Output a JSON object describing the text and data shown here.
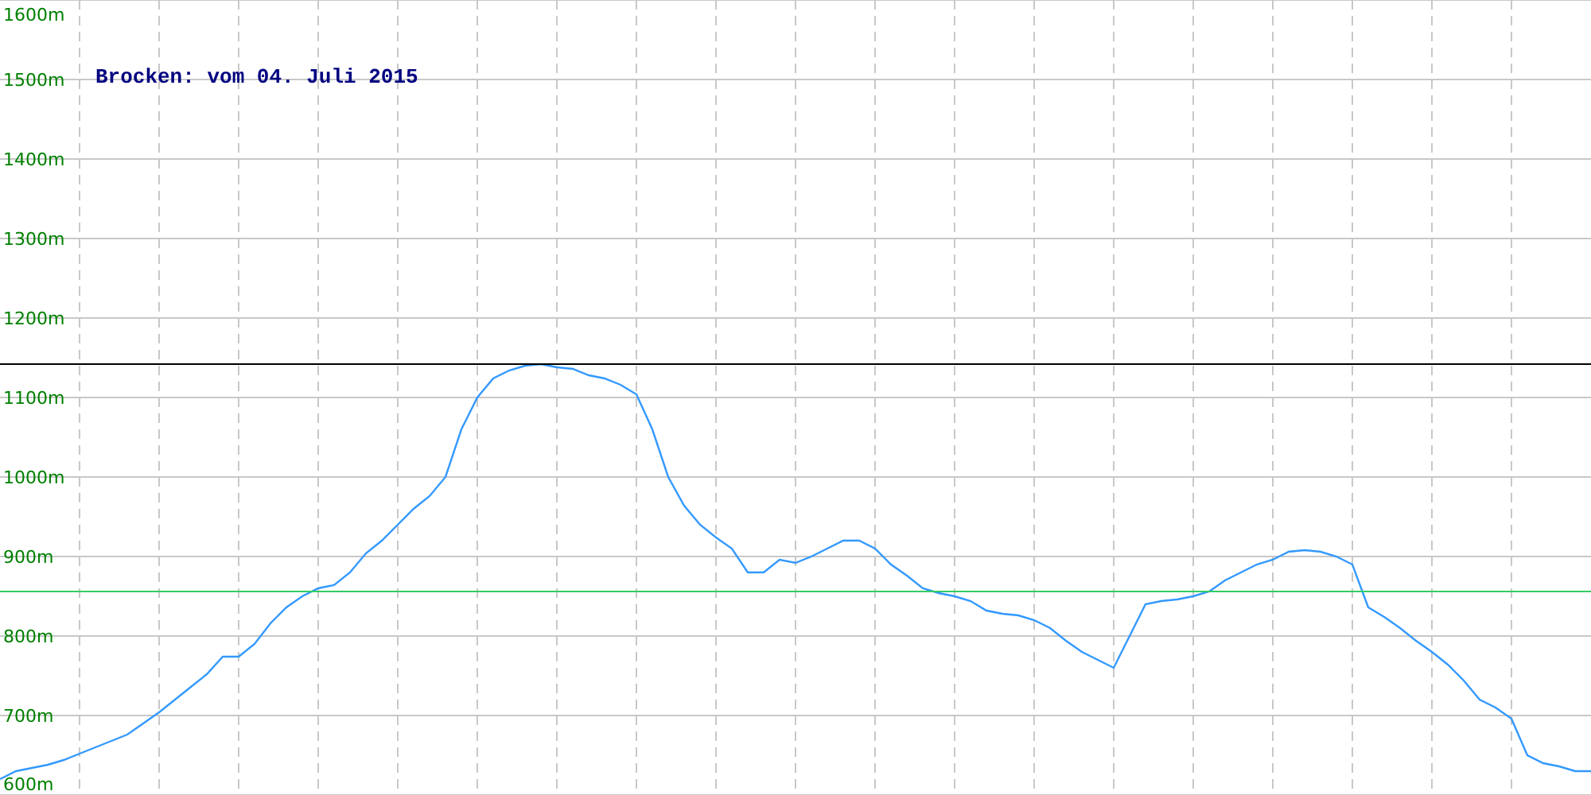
{
  "chart": {
    "chart_data": {
      "type": "line",
      "title": "Brocken: vom 04. Juli 2015",
      "categories": [
        null,
        null,
        null,
        null,
        null,
        null,
        null,
        null,
        null,
        null,
        null,
        null,
        null,
        null,
        null,
        null,
        null,
        null,
        null,
        null,
        null,
        null,
        null,
        null,
        null,
        null,
        null,
        null,
        null,
        null,
        null,
        null,
        null,
        null,
        null,
        null,
        null,
        null,
        null,
        null,
        null,
        null,
        null,
        null,
        null,
        null,
        null,
        null,
        null,
        null,
        null,
        null,
        null,
        null,
        null,
        null,
        null,
        null,
        null,
        null,
        null,
        null,
        null,
        null,
        null,
        null,
        null,
        null,
        null,
        null,
        null,
        null,
        null,
        null,
        null,
        null,
        null,
        null,
        null,
        null,
        null,
        null,
        null,
        null,
        null,
        null,
        null,
        null,
        null,
        null,
        null,
        null,
        null,
        null,
        null,
        null,
        null,
        null,
        null,
        null,
        null
      ],
      "series": [
        {
          "color": "#3399ff",
          "values": [
            620,
            630,
            634,
            638,
            644,
            652,
            660,
            668,
            676,
            690,
            704,
            720,
            736,
            752,
            774,
            774,
            790,
            816,
            836,
            850,
            860,
            864,
            880,
            904,
            920,
            940,
            960,
            976,
            1000,
            1060,
            1100,
            1124,
            1134,
            1140,
            1142,
            1138,
            1136,
            1128,
            1124,
            1116,
            1104,
            1060,
            1000,
            964,
            940,
            924,
            910,
            880,
            880,
            896,
            892,
            900,
            910,
            920,
            920,
            910,
            890,
            876,
            860,
            854,
            850,
            844,
            832,
            828,
            826,
            820,
            810,
            794,
            780,
            770,
            760,
            800,
            840,
            844,
            846,
            850,
            856,
            870,
            880,
            890,
            896,
            906,
            908,
            906,
            900,
            890,
            836,
            824,
            810,
            794,
            780,
            764,
            744,
            720,
            710,
            696,
            650,
            640,
            636,
            630,
            630
          ]
        },
        {
          "color": "#000000",
          "values": [
            1142,
            1142,
            1142,
            1142,
            1142,
            1142,
            1142,
            1142,
            1142,
            1142,
            1142,
            1142,
            1142,
            1142,
            1142,
            1142,
            1142,
            1142,
            1142,
            1142,
            1142,
            1142,
            1142,
            1142,
            1142,
            1142,
            1142,
            1142,
            1142,
            1142,
            1142,
            1142,
            1142,
            1142,
            1142,
            1142,
            1142,
            1142,
            1142,
            1142,
            1142,
            1142,
            1142,
            1142,
            1142,
            1142,
            1142,
            1142,
            1142,
            1142,
            1142,
            1142,
            1142,
            1142,
            1142,
            1142,
            1142,
            1142,
            1142,
            1142,
            1142,
            1142,
            1142,
            1142,
            1142,
            1142,
            1142,
            1142,
            1142,
            1142,
            1142,
            1142,
            1142,
            1142,
            1142,
            1142,
            1142,
            1142,
            1142,
            1142,
            1142,
            1142,
            1142,
            1142,
            1142,
            1142,
            1142,
            1142,
            1142,
            1142,
            1142,
            1142,
            1142,
            1142,
            1142,
            1142,
            1142,
            1142,
            1142,
            1142,
            1142
          ]
        },
        {
          "color": "#33cc66",
          "values": [
            856,
            856,
            856,
            856,
            856,
            856,
            856,
            856,
            856,
            856,
            856,
            856,
            856,
            856,
            856,
            856,
            856,
            856,
            856,
            856,
            856,
            856,
            856,
            856,
            856,
            856,
            856,
            856,
            856,
            856,
            856,
            856,
            856,
            856,
            856,
            856,
            856,
            856,
            856,
            856,
            856,
            856,
            856,
            856,
            856,
            856,
            856,
            856,
            856,
            856,
            856,
            856,
            856,
            856,
            856,
            856,
            856,
            856,
            856,
            856,
            856,
            856,
            856,
            856,
            856,
            856,
            856,
            856,
            856,
            856,
            856,
            856,
            856,
            856,
            856,
            856,
            856,
            856,
            856,
            856,
            856,
            856,
            856,
            856,
            856,
            856,
            856,
            856,
            856,
            856,
            856,
            856,
            856,
            856,
            856,
            856,
            856,
            856,
            856,
            856,
            856
          ]
        }
      ],
      "ylim": [
        600,
        1600
      ],
      "yticks": [
        {
          "value": 600,
          "label": "600m"
        },
        {
          "value": 700,
          "label": "700m"
        },
        {
          "value": 800,
          "label": "800m"
        },
        {
          "value": 900,
          "label": "900m"
        },
        {
          "value": 1000,
          "label": "1000m"
        },
        {
          "value": 1100,
          "label": "1100m"
        },
        {
          "value": 1200,
          "label": "1200m"
        },
        {
          "value": 1300,
          "label": "1300m"
        },
        {
          "value": 1400,
          "label": "1400m"
        },
        {
          "value": 1500,
          "label": "1500m"
        },
        {
          "value": 1600,
          "label": "1600m"
        }
      ],
      "grid": true
    }
  }
}
